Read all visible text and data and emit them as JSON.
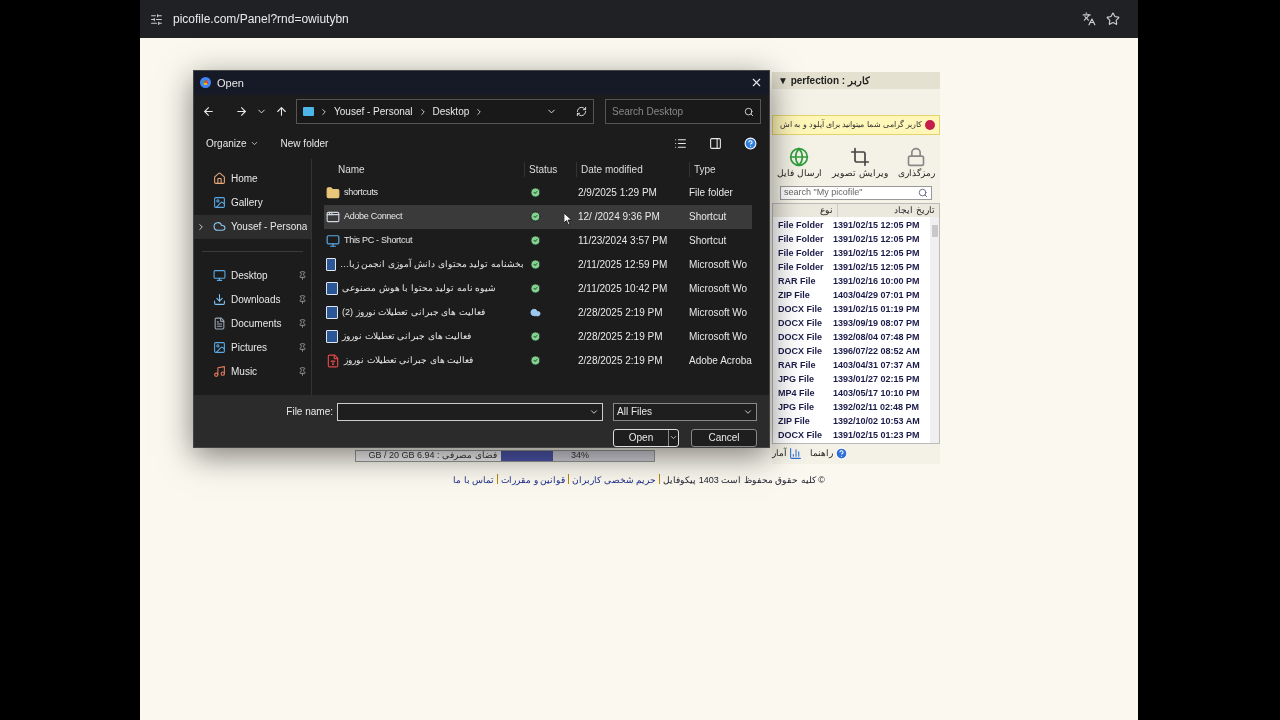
{
  "browser": {
    "url": "picofile.com/Panel?rnd=owiutybn"
  },
  "panel": {
    "user": "کاربر : perfection ▼",
    "notice": "کاربر گرامی شما میتوانید برای آپلود و به اش",
    "tools": [
      {
        "label": "رمزگذاری",
        "kind": "lock"
      },
      {
        "label": "ویرایش تصویر",
        "kind": "crop"
      },
      {
        "label": "ارسال فایل",
        "kind": "globe"
      }
    ],
    "search": {
      "placeholder": "search \"My picofile\""
    },
    "columns": [
      "تاریخ ایجاد",
      "نوع"
    ],
    "rows": [
      {
        "type": "File Folder",
        "date": "1391/02/15 12:05 PM"
      },
      {
        "type": "File Folder",
        "date": "1391/02/15 12:05 PM"
      },
      {
        "type": "File Folder",
        "date": "1391/02/15 12:05 PM"
      },
      {
        "type": "File Folder",
        "date": "1391/02/15 12:05 PM"
      },
      {
        "type": "RAR File",
        "date": "1391/02/16 10:00 PM"
      },
      {
        "type": "ZIP File",
        "date": "1403/04/29 07:01 PM"
      },
      {
        "type": "DOCX File",
        "date": "1391/02/15 01:19 PM"
      },
      {
        "type": "DOCX File",
        "date": "1393/09/19 08:07 PM"
      },
      {
        "type": "DOCX File",
        "date": "1392/08/04 07:48 PM"
      },
      {
        "type": "DOCX File",
        "date": "1396/07/22 08:52 AM"
      },
      {
        "type": "RAR File",
        "date": "1403/04/31 07:37 AM"
      },
      {
        "type": "JPG File",
        "date": "1393/01/27 02:15 PM"
      },
      {
        "type": "MP4 File",
        "date": "1403/05/17 10:10 PM"
      },
      {
        "type": "JPG File",
        "date": "1392/02/11 02:48 PM"
      },
      {
        "type": "ZIP File",
        "date": "1392/10/02 10:53 AM"
      },
      {
        "type": "DOCX File",
        "date": "1391/02/15 01:23 PM"
      }
    ],
    "footer_links": [
      {
        "label": "راهنما",
        "kind": "help"
      },
      {
        "label": "آمار",
        "kind": "stats"
      }
    ],
    "usage": {
      "label": "فضای مصرفی : 6.94 GB / 20 GB",
      "reading": "34%",
      "level": 0.34
    }
  },
  "copyright": {
    "prefix": "© کلیه حقوق محفوظ است 1403 پیکوفایل",
    "links": [
      "حریم شخصی کاربران",
      "قوانین و مقررات",
      "تماس با ما"
    ]
  },
  "dialog": {
    "title": "Open",
    "breadcrumb": [
      "Yousef - Personal",
      "Desktop"
    ],
    "search_placeholder": "Search Desktop",
    "toolbar": [
      "Organize",
      "New folder"
    ],
    "sidebar": [
      {
        "label": "Home",
        "kind": "home",
        "selected": false,
        "pinned": false,
        "expandable": false
      },
      {
        "label": "Gallery",
        "kind": "gallery",
        "selected": false,
        "pinned": false,
        "expandable": false
      },
      {
        "label": "Yousef - Persona",
        "kind": "cloud",
        "selected": true,
        "pinned": false,
        "expandable": true
      },
      {
        "label": "Desktop",
        "kind": "desktop",
        "selected": false,
        "pinned": true,
        "expandable": false
      },
      {
        "label": "Downloads",
        "kind": "download",
        "selected": false,
        "pinned": true,
        "expandable": false
      },
      {
        "label": "Documents",
        "kind": "document",
        "selected": false,
        "pinned": true,
        "expandable": false
      },
      {
        "label": "Pictures",
        "kind": "picture",
        "selected": false,
        "pinned": true,
        "expandable": false
      },
      {
        "label": "Music",
        "kind": "music",
        "selected": false,
        "pinned": true,
        "expandable": false
      }
    ],
    "columns": [
      "Name",
      "Status",
      "Date modified",
      "Type"
    ],
    "files": [
      {
        "name": "shortcuts",
        "kind": "folder",
        "synced": true,
        "date": "2/9/2025 1:29 PM",
        "type": "File folder",
        "selected": false
      },
      {
        "name": "Adobe Connect",
        "kind": "app",
        "synced": true,
        "date": "12/ /2024 9:36 PM",
        "type": "Shortcut",
        "selected": true
      },
      {
        "name": "This PC - Shortcut",
        "kind": "pc",
        "synced": true,
        "date": "11/23/2024 3:57 PM",
        "type": "Shortcut",
        "selected": false
      },
      {
        "name": "بخشنامه تولید محتوای دانش آموزی انجمن زبا…",
        "kind": "word",
        "synced": true,
        "date": "2/11/2025 12:59 PM",
        "type": "Microsoft Wo",
        "selected": false
      },
      {
        "name": "شیوه نامه تولید محتوا با هوش مصنوعی",
        "kind": "word",
        "synced": true,
        "date": "2/11/2025 10:42 PM",
        "type": "Microsoft Wo",
        "selected": false
      },
      {
        "name": "فعالیت های جبرانی تعطیلات نوروز (2)",
        "kind": "word",
        "synced": false,
        "date": "2/28/2025 2:19 PM",
        "type": "Microsoft Wo",
        "selected": false
      },
      {
        "name": "فعالیت های جبرانی تعطیلات نوروز",
        "kind": "word",
        "synced": true,
        "date": "2/28/2025 2:19 PM",
        "type": "Microsoft Wo",
        "selected": false
      },
      {
        "name": "فعالیت های جبرانی تعطیلات نوروز",
        "kind": "pdf",
        "synced": true,
        "date": "2/28/2025 2:19 PM",
        "type": "Adobe Acroba",
        "selected": false
      }
    ],
    "file_name_label": "File name:",
    "filter": "All Files",
    "buttons": [
      "Open",
      "Cancel"
    ]
  }
}
